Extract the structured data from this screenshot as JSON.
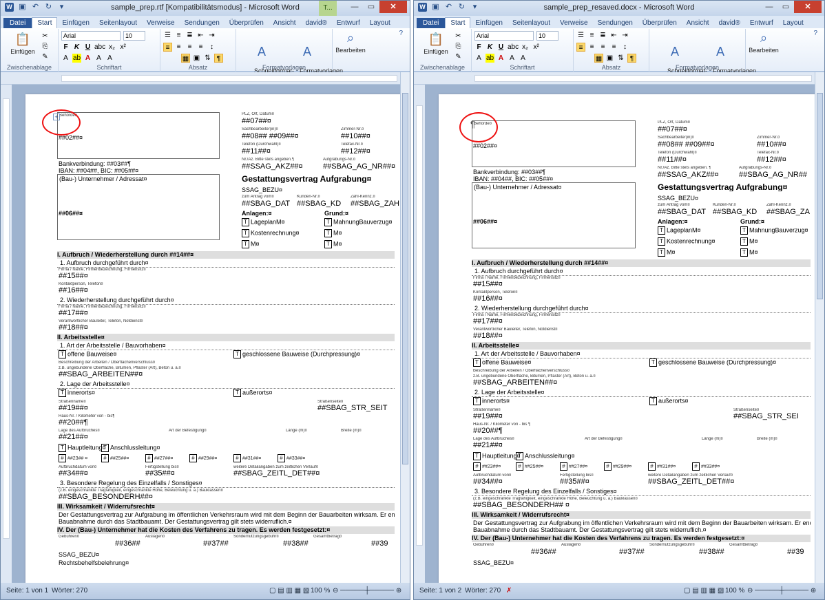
{
  "left": {
    "title": "sample_prep.rtf [Kompatibilitätsmodus] - Microsoft Word",
    "context_tab": "T...",
    "tabs": [
      "Datei",
      "Start",
      "Einfügen",
      "Seitenlayout",
      "Verweise",
      "Sendungen",
      "Überprüfen",
      "Ansicht",
      "david®",
      "Entwurf",
      "Layout"
    ],
    "font": "Arial",
    "size": "10",
    "groups": {
      "clipboard": "Zwischenablage",
      "font": "Schriftart",
      "paragraph": "Absatz",
      "styles": "Formatvorlagen"
    },
    "buttons": {
      "paste": "Einfügen",
      "quickstyles": "Schnellformat-\nvorlagen",
      "changestyles": "Formatvorlagen\nändern",
      "edit": "Bearbeiten"
    },
    "status": {
      "page": "Seite: 1 von 1",
      "words": "Wörter: 270",
      "zoom": "100 %"
    },
    "doc": {
      "behoerde": "Behörde¤",
      "f02": "##02##¤",
      "plz": "PLZ, Ort, Datum¤",
      "f07": "##07##¤",
      "sach": "Sachbearbeiter(in)¤",
      "zimmer": "Zimmer-Nr.¤",
      "f0809": "##08## ##09##¤",
      "f10": "##10##¤",
      "tel": "Telefon (Durchwahl)¤",
      "fax": "Telefax-Nr.¤",
      "f11": "##11##¤",
      "f12": "##12##¤",
      "bank": "Bankverbindung: ##03##¶",
      "iban": "IBAN: ##04##, BIC: ##05##¤",
      "nraz": "Nr./Az. Bitte stets angeben.¶",
      "auftrag": "Aufgrabungs-Nr.¤",
      "akz": "##SSAG_AKZ##¤",
      "agnr": "##SBAG_AG_NR##¤",
      "unternehmer": "(Bau-) Unternehmer / Adressat¤",
      "vertrag": "Gestattungsvertrag Aufgrabung¤",
      "bezu": "SSAG_BEZU¤",
      "antrag": "zum Antrag vom¤",
      "kunden": "Kunden-Nr.¤",
      "zahl": "Zahl-Kennz.¤",
      "dat": "##SBAG_DAT",
      "kd": "##SBAG_KD",
      "zah": "##SBAG_ZAH",
      "f06": "##06##¤",
      "anlagen": "Anlagen:¤",
      "grund": "Grund:¤",
      "lageplan": "LageplanM¤",
      "mahnung": "MahnungBauverzug¤",
      "kosten": "Kostenrechnung¤",
      "m1": "M¤",
      "m2": "M¤",
      "m3": "M¤",
      "s1": "I. Aufbruch / Wiederherstellung durch ##14##¤",
      "s1a": "1. Aufbruch durchgeführt durch¤",
      "firma": "Firma / Name, Firmenbezeichnung, Firmensitz¤",
      "f15": "##15##¤",
      "kontakt": "Kontaktperson, Telefon¤",
      "f16": "##16##¤",
      "s1b": "2. Wiederherstellung durchgeführt durch¤",
      "firma2": "Firma / Name, Firmenbezeichnung, Firmensitz¤",
      "f17": "##17##¤",
      "verant": "Verantwortlicher Bauleiter, Telefon, Notdienst¤",
      "f18": "##18##¤",
      "s2": "II. Arbeitsstelle¤",
      "s2a": "1. Art der Arbeitsstelle / Bauvorhaben¤",
      "offen": "offene Bauweise¤",
      "geschl": "geschlossene Bauweise (Durchpressung)¤",
      "beschr": "Beschreibung der Arbeiten / Oberflächenverschluss¤",
      "zb": "z.B. ungebundene Oberfläche, Bitumen, Pflaster (Art), Beton u. a.¤",
      "arbeiten": "##SBAG_ARBEITEN##¤",
      "s2b": "2. Lage der Arbeitsstelle¤",
      "innerorts": "innerorts¤",
      "ausserorts": "außerorts¤",
      "strasse": "Straßenname¤",
      "strseite": "Straßenseite¤",
      "f19": "##19##¤",
      "strseit": "##SBAG_STR_SEIT",
      "hausnr": "Haus-Nr. / Kilometer von - bis¶",
      "f20": "##20##¶",
      "lage": "Lage des Aufbruches¤",
      "befest": "Art der Befestigung¤",
      "laenge": "Länge (m)¤",
      "breite": "Breite (m)¤",
      "f21": "##21##¤",
      "haupt": "Hauptleitung¤",
      "ansch": "Anschlussleitung¤",
      "f23": "##23## ¤",
      "f25": "##25##¤",
      "f27": "##27##¤",
      "f29": "##29##¤",
      "f31": "##31##¤",
      "f33": "##33##¤",
      "aufbruchdat": "Aufbruchdatum von¤",
      "fertig": "Fertigstellung bis¤",
      "weitere": "weitere Detailangaben zum zeitlichen Verlauf¤",
      "f34": "##34##¤",
      "f35": "##35##¤",
      "zeitl": "##SBAG_ZEITL_DET##¤",
      "s2c": "3. Besondere Regelung des Einzelfalls / Sonstiges¤",
      "zb2": "(z.B. eingeschränkte Tragfähigkeit, eingeschränkte Höhe, Beleuchtung u. a.) Bauklassen¤",
      "besonderh": "##SBAG_BESONDERH##¤",
      "s3": "III. Wirksamkeit / Widerrufsrecht¤",
      "text1": "Der Gestattungsvertrag zur Aufgrabung im öffentlichen Verkehrsraum wird mit dem Beginn der Bauarbeiten wirksam. Er endet mit der",
      "text2": "Bauabnahme durch das Stadtbauamt. Der Gestattungsvertrag gilt stets widerruflich.¤",
      "s4": "IV. Der (Bau-) Unternehmer hat die Kosten des Verfahrens zu tragen. Es werden festgesetzt:¤",
      "gebuehr": "Gebühren¤",
      "auslagen": "Auslagen¤",
      "sonder": "Sondernutzungsgebühr¤",
      "gesamt": "Gesamtbetrag¤",
      "f36": "##36##",
      "f37": "##37##",
      "f38": "##38##",
      "f39": "##39",
      "bezu2": "SSAG_BEZU¤",
      "rechts": "Rechtsbehelfsbelehrung¤"
    }
  },
  "right": {
    "title": "sample_prep_resaved.docx - Microsoft Word",
    "tabs": [
      "Datei",
      "Start",
      "Einfügen",
      "Seitenlayout",
      "Verweise",
      "Sendungen",
      "Überprüfen",
      "Ansicht",
      "david®",
      "Entwurf",
      "Layout"
    ],
    "font": "Arial",
    "size": "10",
    "groups": {
      "clipboard": "Zwischenablage",
      "font": "Schriftart",
      "paragraph": "Absatz",
      "styles": "Formatvorlagen"
    },
    "buttons": {
      "paste": "Einfügen",
      "quickstyles": "Schnellformat-\nvorlagen",
      "changestyles": "Formatvorlagen\nändern",
      "edit": "Bearbeiten"
    },
    "status": {
      "page": "Seite: 1 von 2",
      "words": "Wörter: 270",
      "zoom": "100 %"
    },
    "doc": {
      "pilcrow": "¶",
      "behoerde": "Behörde¤",
      "f02": "##02##¤",
      "plz": "PLZ, Ort, Datum¤",
      "f07": "##07##¤",
      "sach": "Sachbearbeiter(in)¤",
      "zimmer": "Zimmer-Nr.¤",
      "f0809": "##08## ##09##¤",
      "f10": "##10##¤",
      "tel": "Telefon (Durchwahl)¤",
      "fax": "Telefax-Nr.¤",
      "f11": "##11##¤",
      "f12": "##12##¤",
      "bank": "Bankverbindung: ##03##¶",
      "iban": "IBAN: ##04##, BIC: ##05##¤",
      "nraz": "Nr./Az. Bitte stets angeben. ¶",
      "auftrag": "Aufgrabungs-Nr.¤",
      "akz": "##SSAG_AKZ##¤",
      "agnr": "##SBAG_AG_NR##",
      "unternehmer": "(Bau-) Unternehmer / Adressat¤",
      "vertrag": "Gestattungsvertrag Aufgrabung¤",
      "bezu": "SSAG_BEZU¤",
      "antrag": "zum Antrag vom¤",
      "kunden": "Kunden-Nr.¤",
      "zahl": "Zahl-Kennz.¤",
      "dat": "##SBAG_DAT",
      "kd": "##SBAG_KD",
      "zah": "##SBAG_ZA",
      "f06": "##06##¤",
      "anlagen": "Anlagen:¤",
      "grund": "Grund:¤",
      "lageplan": "LageplanM¤",
      "mahnung": "MahnungBauverzug¤",
      "kosten": "Kostenrechnung¤",
      "m1": "M¤",
      "m2": "M¤",
      "m3": "M¤",
      "s1": "I. Aufbruch / Wiederherstellung durch ##14##¤",
      "s1a": "1. Aufbruch durchgeführt durch¤",
      "firma": "Firma / Name, Firmenbezeichnung, Firmensitz¤",
      "f15": "##15##¤",
      "kontakt": "Kontaktperson, Telefon¤",
      "f16": "##16##¤",
      "s1b": "2. Wiederherstellung durchgeführt durch¤",
      "firma2": "Firma / Name, Firmenbezeichnung, Firmensitz¤",
      "f17": "##17##¤",
      "verant": "Verantwortlicher Bauleiter, Telefon, Notdienst¤",
      "f18": "##18##¤",
      "s2": "II. Arbeitsstelle¤",
      "s2a": "1. Art der Arbeitsstelle / Bauvorhaben¤",
      "offen": "offene Bauweise¤",
      "geschl": "geschlossene Bauweise (Durchpressung)¤",
      "beschr": "Beschreibung der Arbeiten / Oberflächenverschluss¤",
      "zb": "z.B. ungebundene Oberfläche, Bitumen, Pflaster (Art), Beton u. a.¤",
      "arbeiten": "##SBAG_ARBEITEN##¤",
      "s2b": "2. Lage der Arbeitsstelle¤",
      "innerorts": "innerorts¤",
      "ausserorts": "außerorts¤",
      "strasse": "Straßenname¤",
      "strseite": "Straßenseite¤",
      "f19": "##19##¤",
      "strseit": "##SBAG_STR_SEI",
      "hausnr": "Haus-Nr. / Kilometer von - bis ¶",
      "f20": "##20##¶",
      "lage": "Lage des Aufbruches¤",
      "befest": "Art der Befestigung¤",
      "laenge": "Länge (m)¤",
      "breite": "Breite (m)¤",
      "f21": "##21##¤",
      "haupt": "Hauptleitung¤",
      "ansch": "Anschlussleitung¤",
      "f23": "##23##¤",
      "f25": "##25##¤",
      "f27": "##27##¤",
      "f29": "##29##¤",
      "f31": "##31##¤",
      "f33": "##33##¤",
      "aufbruchdat": "Aufbruchdatum von¤",
      "fertig": "Fertigstellung bis¤",
      "weitere": "weitere Detailangaben zum zeitlichen Verlauf¤",
      "f34": "##34##¤",
      "f35": "##35##¤",
      "zeitl": "##SBAG_ZEITL_DET##¤",
      "s2c": "3. Besondere Regelung des Einzelfalls / Sonstiges¤",
      "zb2": "(z.B. eingeschränkte Tragfähigkeit, eingeschränkte Höhe, Beleuchtung u. a.) Bauklassen¤",
      "besonderh": "##SBAG_BESONDERH## ¤",
      "s3": "III. Wirksamkeit / Widerrufsrecht¤",
      "text1": "Der Gestattungsvertrag zur Aufgrabung im öffentlichen Verkehrsraum wird mit dem Beginn der Bauarbeiten wirksam. Er endet mit der",
      "text2": "Bauabnahme durch das Stadtbauamt. Der Gestattungsvertrag gilt stets widerruflich.¤",
      "s4": "IV. Der (Bau-) Unternehmer hat die Kosten des Verfahrens zu tragen. Es werden festgesetzt:¤",
      "gebuehr": "Gebühren¤",
      "auslagen": "Auslagen¤",
      "sonder": "Sondernutzungsgebühr¤",
      "gesamt": "Gesamtbetrag¤",
      "f36": "##36##",
      "f37": "##37##",
      "f38": "##38##",
      "f39": "##39",
      "bezu2": "SSAG_BEZU¤"
    }
  },
  "colors": {
    "accent": "#2b579a",
    "annotation": "#e11111",
    "context_tab": "#b7d58f"
  }
}
